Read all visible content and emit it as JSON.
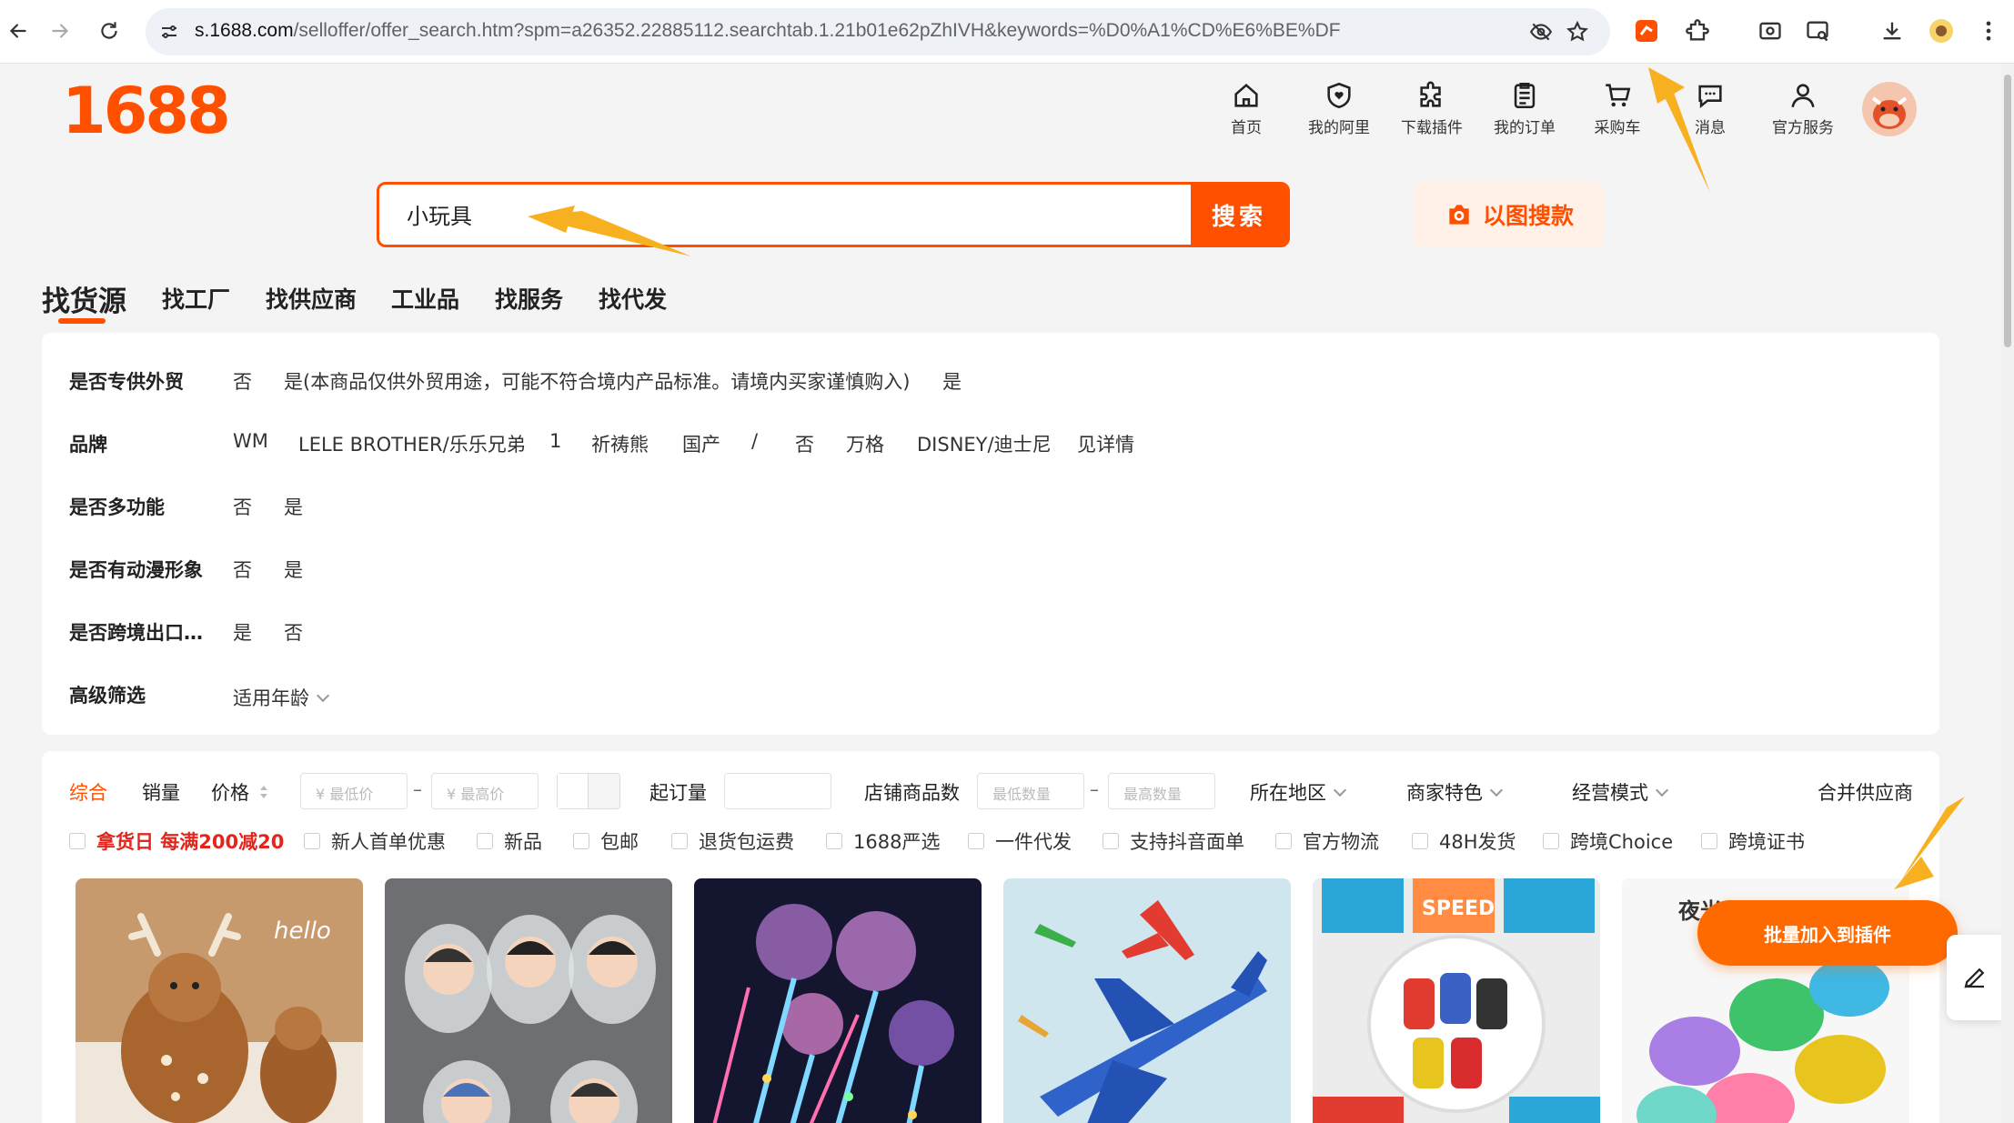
{
  "browser": {
    "url_host": "s.1688.com",
    "url_rest": "/selloffer/offer_search.htm?spm=a26352.22885112.searchtab.1.21b01e62pZhIVH&keywords=%D0%A1%CD%E6%BE%DF"
  },
  "site": {
    "logo": "1688",
    "brand_color": "#ff5000",
    "topnav": [
      {
        "label": "首页",
        "icon": "home-icon"
      },
      {
        "label": "我的阿里",
        "icon": "heart-shield-icon"
      },
      {
        "label": "下载插件",
        "icon": "puzzle-icon"
      },
      {
        "label": "我的订单",
        "icon": "clipboard-icon"
      },
      {
        "label": "采购车",
        "icon": "cart-icon"
      },
      {
        "label": "消息",
        "icon": "message-icon"
      },
      {
        "label": "官方服务",
        "icon": "user-icon"
      }
    ]
  },
  "search": {
    "query": "小玩具",
    "button": "搜索",
    "image_search": "以图搜款"
  },
  "category_tabs": [
    "找货源",
    "找工厂",
    "找供应商",
    "工业品",
    "找服务",
    "找代发"
  ],
  "filters": [
    {
      "label": "是否专供外贸",
      "options": [
        "否",
        "是(本商品仅供外贸用途，可能不符合境内产品标准。请境内买家谨慎购入)",
        "是"
      ]
    },
    {
      "label": "品牌",
      "options": [
        "WM",
        "LELE BROTHER/乐乐兄弟",
        "1",
        "祈祷熊",
        "国产",
        "/",
        "否",
        "万格",
        "DISNEY/迪士尼",
        "见详情"
      ]
    },
    {
      "label": "是否多功能",
      "options": [
        "否",
        "是"
      ]
    },
    {
      "label": "是否有动漫形象",
      "options": [
        "否",
        "是"
      ]
    },
    {
      "label": "是否跨境出口…",
      "options": [
        "是",
        "否"
      ]
    },
    {
      "label": "高级筛选",
      "options": [
        "适用年龄"
      ]
    }
  ],
  "sort_bar": {
    "comprehensive": "综合",
    "sales": "销量",
    "price": "价格",
    "min_price_placeholder": "¥ 最低价",
    "max_price_placeholder": "¥ 最高价",
    "moq": "起订量",
    "store_count": "店铺商品数",
    "min_qty_placeholder": "最低数量",
    "max_qty_placeholder": "最高数量",
    "region": "所在地区",
    "merchant": "商家特色",
    "business": "经营模式",
    "merge": "合并供应商"
  },
  "checkboxes": [
    "拿货日 每满200减20",
    "新人首单优惠",
    "新品",
    "包邮",
    "退货包运费",
    "1688严选",
    "一件代发",
    "支持抖音面单",
    "官方物流",
    "48H发货",
    "跨境Choice",
    "跨境证书"
  ],
  "overlay": {
    "batch_button": "批量加入到插件",
    "product6_label": "夜光"
  }
}
